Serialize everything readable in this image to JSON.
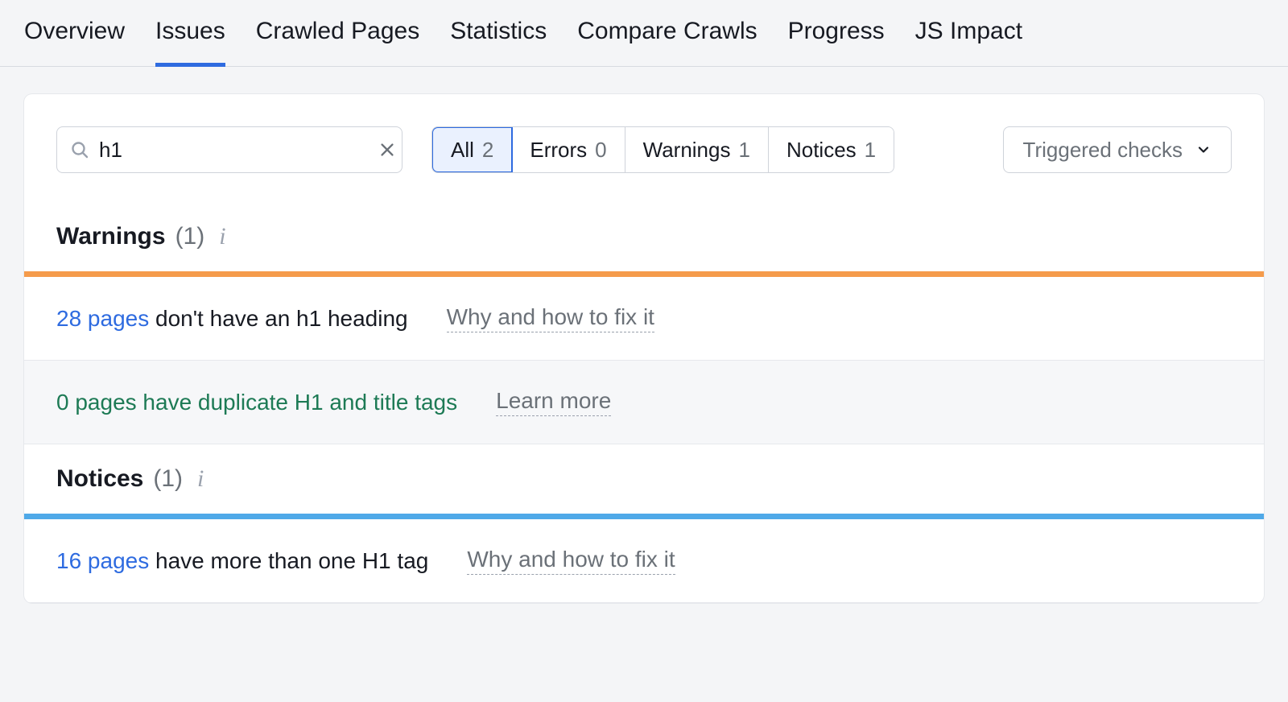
{
  "tabs": {
    "overview": "Overview",
    "issues": "Issues",
    "crawled_pages": "Crawled Pages",
    "statistics": "Statistics",
    "compare": "Compare Crawls",
    "progress": "Progress",
    "js_impact": "JS Impact",
    "active": "issues"
  },
  "search": {
    "value": "h1",
    "placeholder": ""
  },
  "filter": {
    "all_label": "All",
    "all_count": "2",
    "errors_label": "Errors",
    "errors_count": "0",
    "warnings_label": "Warnings",
    "warnings_count": "1",
    "notices_label": "Notices",
    "notices_count": "1"
  },
  "dropdown": {
    "label": "Triggered checks"
  },
  "warnings": {
    "title": "Warnings",
    "count": "(1)",
    "rows": [
      {
        "metric": "28 pages",
        "desc": " don't have an h1 heading",
        "hint": "Why and how to fix it"
      },
      {
        "lead": "0 pages have duplicate H1 and title tags",
        "hint": "Learn more"
      }
    ]
  },
  "notices": {
    "title": "Notices",
    "count": "(1)",
    "rows": [
      {
        "metric": "16 pages",
        "desc": " have more than one H1 tag",
        "hint": "Why and how to fix it"
      }
    ]
  }
}
